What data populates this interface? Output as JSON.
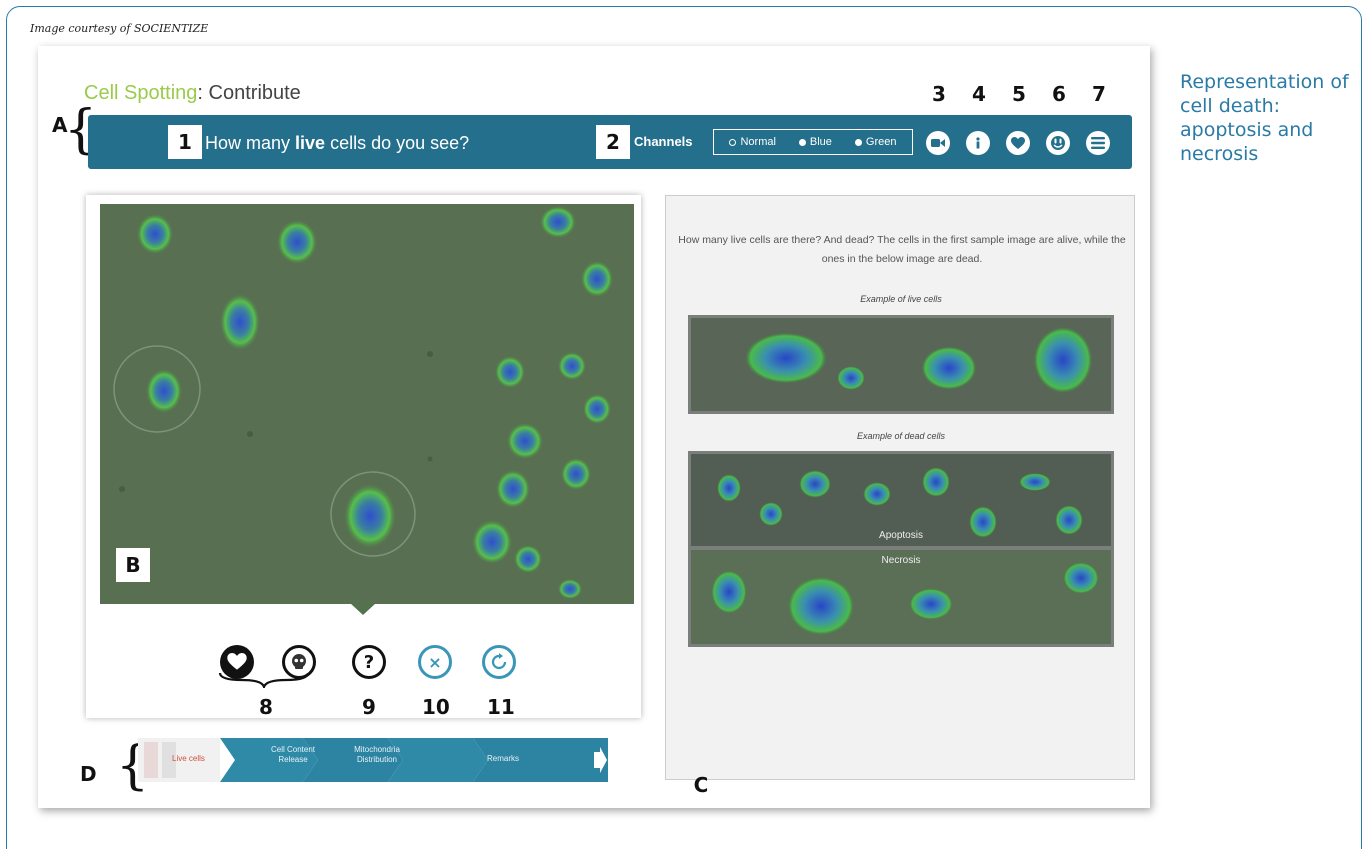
{
  "credit": "Image courtesy of SOCIENTIZE",
  "caption": "Representation of cell death: apoptosis and necrosis",
  "app": {
    "title_brand": "Cell Spotting",
    "title_sep": ":",
    "title_page": "Contribute"
  },
  "callouts": {
    "A": "A",
    "B": "B",
    "C": "C",
    "D": "D",
    "n1": "1",
    "n2": "2",
    "n3": "3",
    "n4": "4",
    "n5": "5",
    "n6": "6",
    "n7": "7",
    "n8": "8",
    "n9": "9",
    "n10": "10",
    "n11": "11"
  },
  "toolbar": {
    "question_pre": "How many ",
    "question_bold": "live",
    "question_post": " cells do you see?",
    "channels_label": "Channels",
    "channels": [
      {
        "label": "Normal",
        "selected": true
      },
      {
        "label": "Blue",
        "selected": false
      },
      {
        "label": "Green",
        "selected": false
      }
    ],
    "icons": [
      "video-icon",
      "info-icon",
      "heart-icon",
      "face-icon",
      "menu-icon"
    ]
  },
  "controls": [
    "heart-icon",
    "skull-icon",
    "question-icon",
    "close-icon",
    "refresh-icon"
  ],
  "help": {
    "instructions": "How many live cells are there? And dead? The cells in the first sample image are alive, while the ones in the below image are dead.",
    "live_label": "Example of live cells",
    "dead_label": "Example of dead cells",
    "apoptosis": "Apoptosis",
    "necrosis": "Necrosis"
  },
  "breadcrumb": {
    "steps": [
      "Live cells",
      "Cell Content Release",
      "Mitochondria Distribution",
      "Remarks"
    ]
  }
}
